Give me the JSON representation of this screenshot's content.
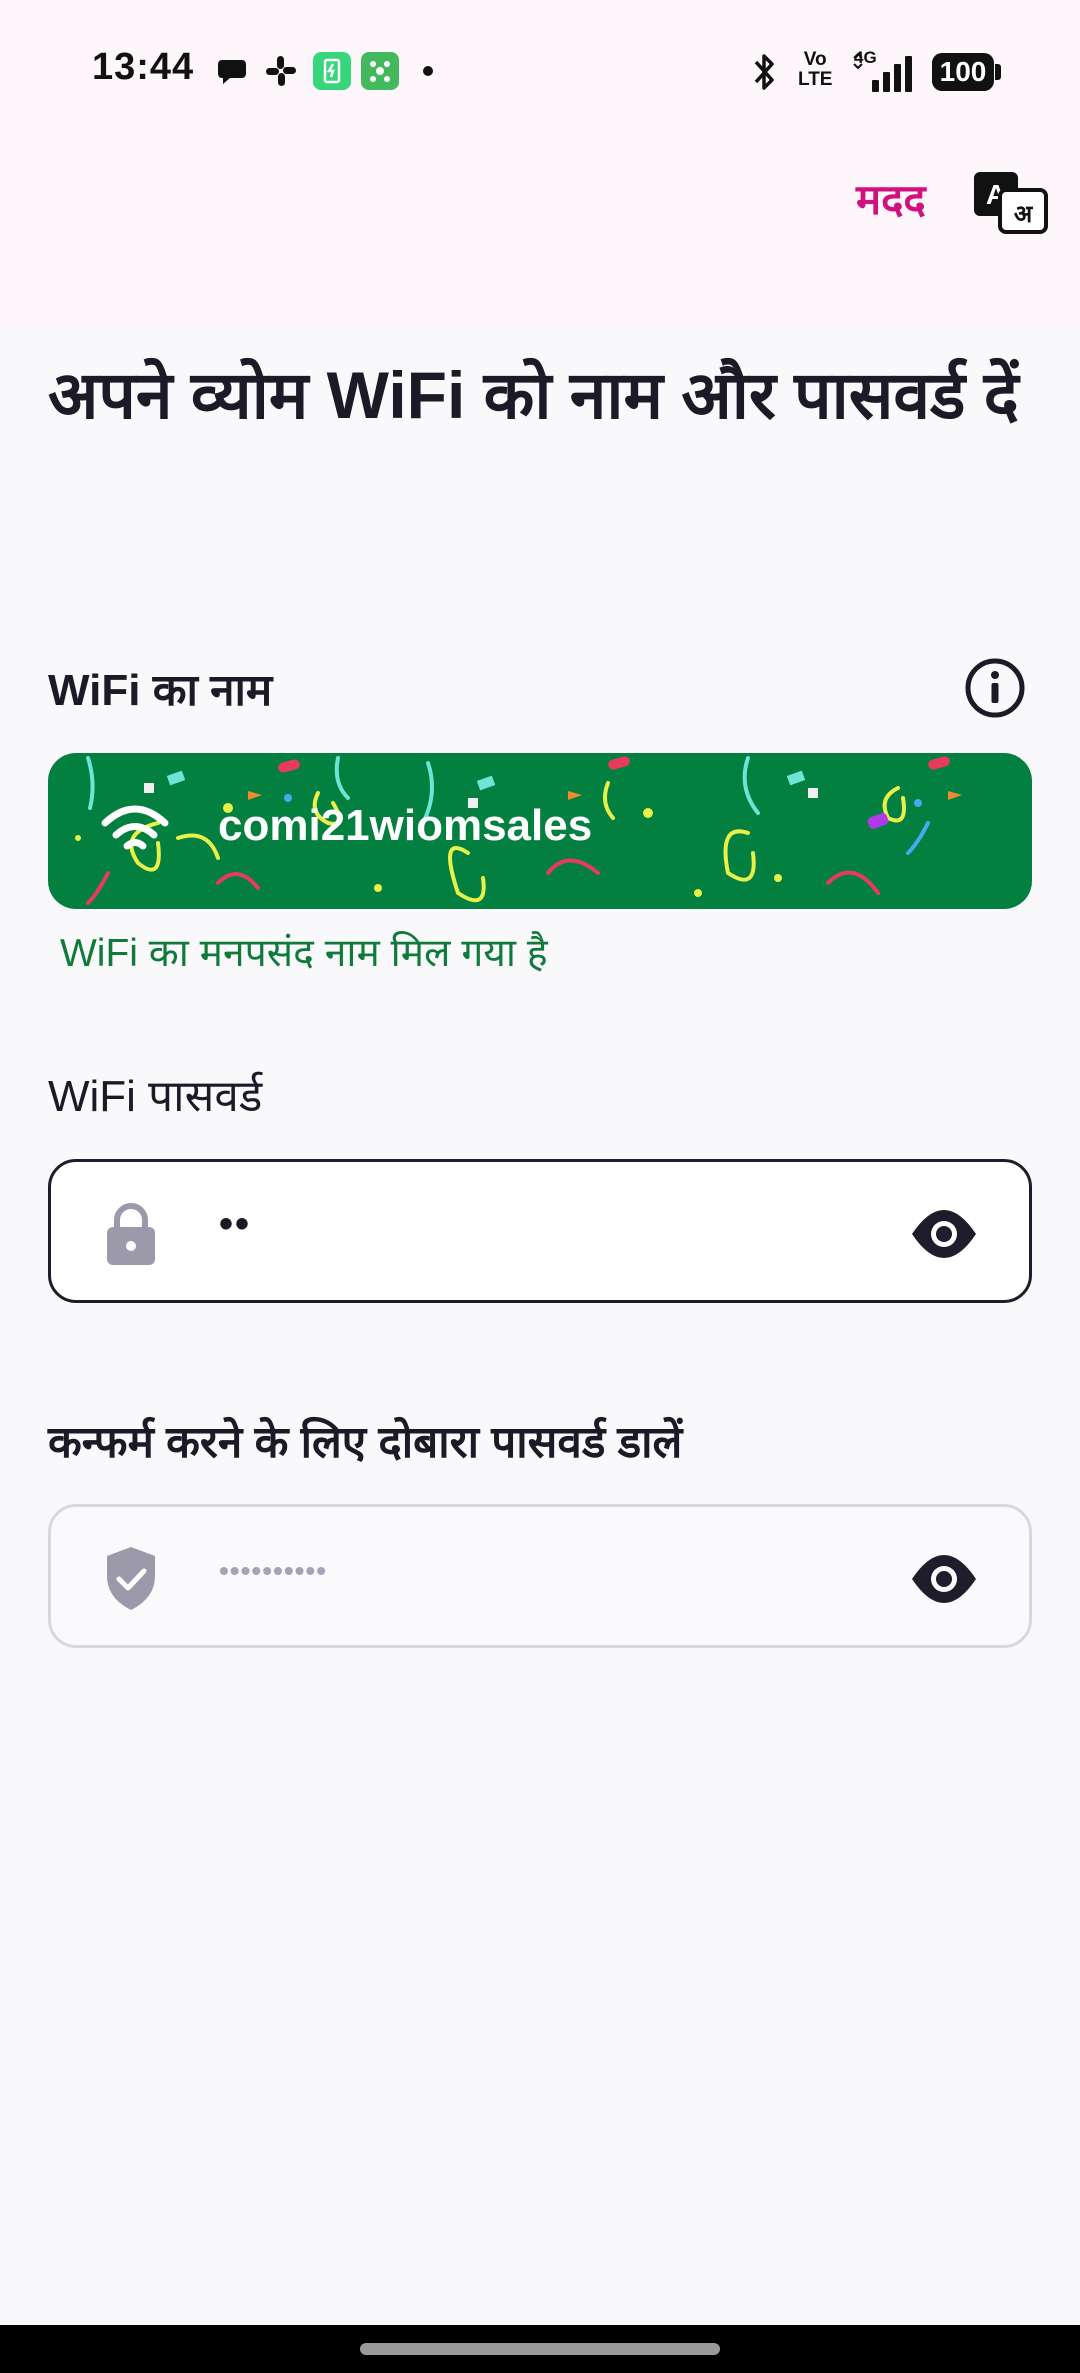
{
  "status_bar": {
    "time": "13:44",
    "network_labels": {
      "volte_top": "Vo",
      "volte_bottom": "LTE",
      "network_type": "4G"
    },
    "battery": "100",
    "icons": [
      "chat-bubble-icon",
      "slack-icon",
      "battery-saver-app-icon",
      "shop-app-icon",
      "notification-dot-icon",
      "bluetooth-icon",
      "signal-icon"
    ]
  },
  "header": {
    "help_label": "मदद",
    "language_icon": "translate-icon",
    "language_glyph_en": "A",
    "language_glyph_hi": "अ"
  },
  "page": {
    "title": "अपने व्योम WiFi को नाम और पासवर्ड दें"
  },
  "wifi_name": {
    "label": "WiFi का नाम",
    "info_icon": "info-icon",
    "value": "comi21wiomsales",
    "success_message": "WiFi का मनपसंद नाम मिल गया है"
  },
  "password": {
    "label": "WiFi पासवर्ड",
    "value": "••",
    "lead_icon": "lock-icon",
    "toggle_icon": "eye-icon"
  },
  "confirm_password": {
    "label": "कन्फर्म करने के लिए दोबारा पासवर्ड डालें",
    "placeholder": "••••••••••",
    "lead_icon": "shield-check-icon",
    "toggle_icon": "eye-icon"
  },
  "colors": {
    "accent_pink": "#D1127E",
    "banner_green": "#038040",
    "success_green": "#0F7A3A",
    "text_dark": "#1B1A26"
  }
}
